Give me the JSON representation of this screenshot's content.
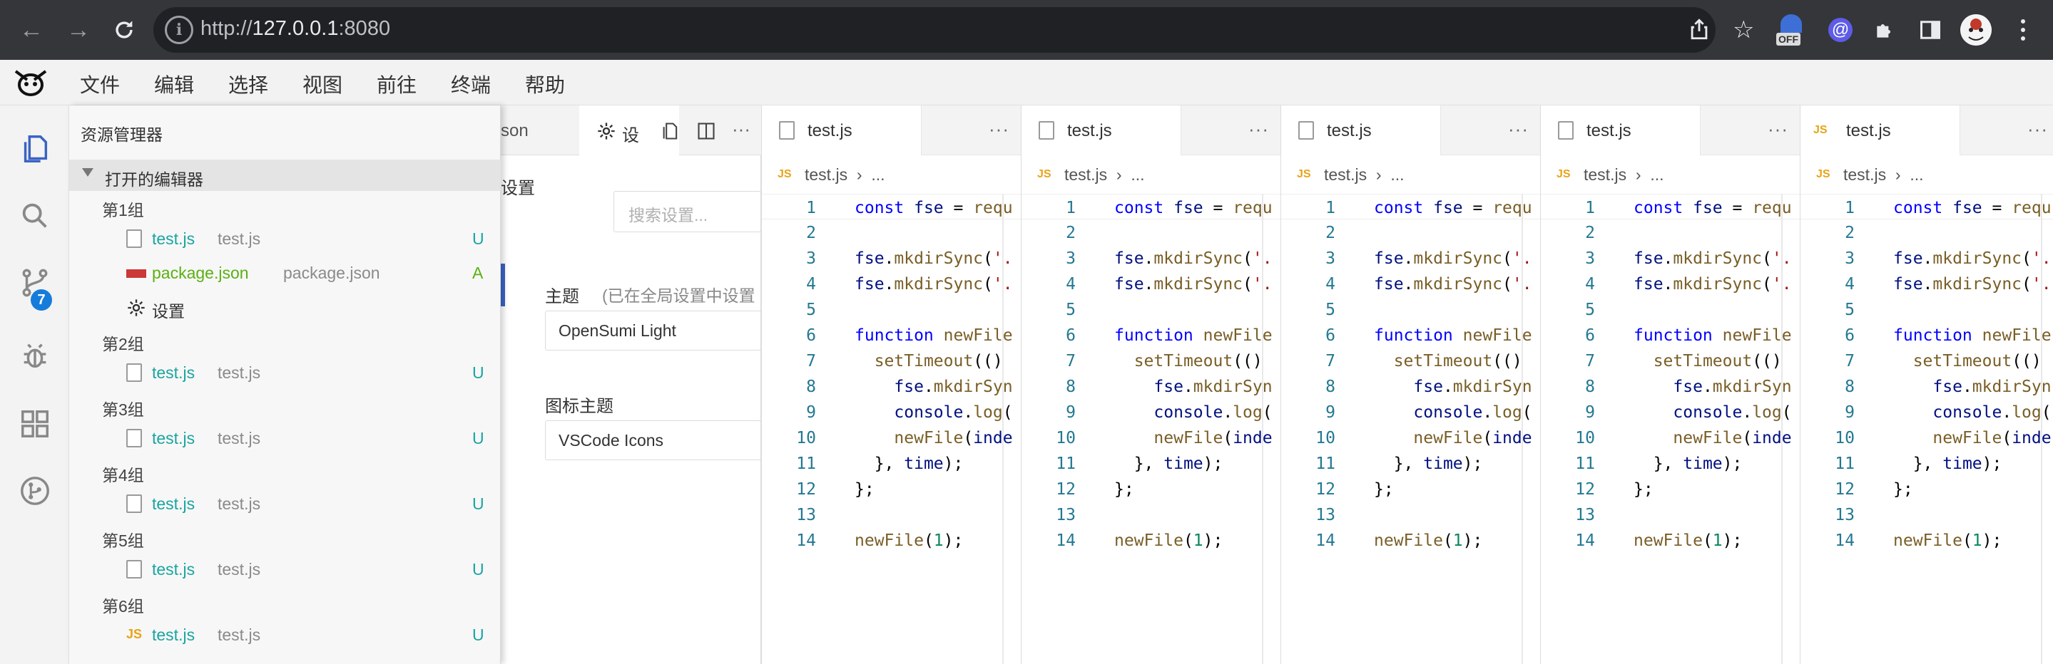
{
  "browser": {
    "url_scheme": "http://",
    "url_host": "127.0.0.1",
    "url_port": ":8080",
    "ext_off_label": "OFF"
  },
  "menu": [
    "文件",
    "编辑",
    "选择",
    "视图",
    "前往",
    "终端",
    "帮助"
  ],
  "activity": {
    "scm_badge": "7"
  },
  "explorer": {
    "title": "资源管理器",
    "open_editors_label": "打开的编辑器",
    "groups": [
      {
        "label": "第1组",
        "files": [
          {
            "name": "test.js",
            "desc": "test.js",
            "status": "U",
            "icon": "file-icon"
          },
          {
            "name": "package.json",
            "desc": "package.json",
            "status": "A",
            "icon": "npm-icon"
          },
          {
            "name": "设置",
            "desc": "",
            "status": "",
            "icon": "gear-icon"
          }
        ]
      },
      {
        "label": "第2组",
        "files": [
          {
            "name": "test.js",
            "desc": "test.js",
            "status": "U",
            "icon": "file-icon"
          }
        ]
      },
      {
        "label": "第3组",
        "files": [
          {
            "name": "test.js",
            "desc": "test.js",
            "status": "U",
            "icon": "file-icon"
          }
        ]
      },
      {
        "label": "第4组",
        "files": [
          {
            "name": "test.js",
            "desc": "test.js",
            "status": "U",
            "icon": "file-icon"
          }
        ]
      },
      {
        "label": "第5组",
        "files": [
          {
            "name": "test.js",
            "desc": "test.js",
            "status": "U",
            "icon": "file-icon"
          }
        ]
      },
      {
        "label": "第6组",
        "files": [
          {
            "name": "test.js",
            "desc": "test.js",
            "status": "U",
            "icon": "js-icon"
          }
        ]
      }
    ]
  },
  "settings": {
    "tab_partial_json": "son",
    "tab_partial_settings": "设",
    "side_label": "设置",
    "search_placeholder": "搜索设置...",
    "theme_label": "主题",
    "theme_note": "(已在全局设置中设置",
    "theme_value": "OpenSumi Light",
    "icon_theme_label": "图标主题",
    "icon_theme_value": "VSCode Icons"
  },
  "editors": [
    {
      "tab": "test.js",
      "crumb_file": "test.js",
      "crumb_more": "...",
      "more": "···",
      "tab_icon": "file-icon"
    },
    {
      "tab": "test.js",
      "crumb_file": "test.js",
      "crumb_more": "...",
      "more": "···",
      "tab_icon": "file-icon"
    },
    {
      "tab": "test.js",
      "crumb_file": "test.js",
      "crumb_more": "...",
      "more": "···",
      "tab_icon": "file-icon"
    },
    {
      "tab": "test.js",
      "crumb_file": "test.js",
      "crumb_more": "...",
      "more": "···",
      "tab_icon": "file-icon"
    },
    {
      "tab": "test.js",
      "crumb_file": "test.js",
      "crumb_more": "...",
      "more": "···",
      "tab_icon": "js-icon"
    }
  ],
  "crumb_js": "JS",
  "code_lines": [
    "const fse = requ",
    "",
    "fse.mkdirSync('.",
    "fse.mkdirSync('.",
    "",
    "function newFile",
    "  setTimeout(()",
    "    fse.mkdirSyn",
    "    console.log(",
    "    newFile(inde",
    "  }, time);",
    "};",
    "",
    "newFile(1);"
  ]
}
